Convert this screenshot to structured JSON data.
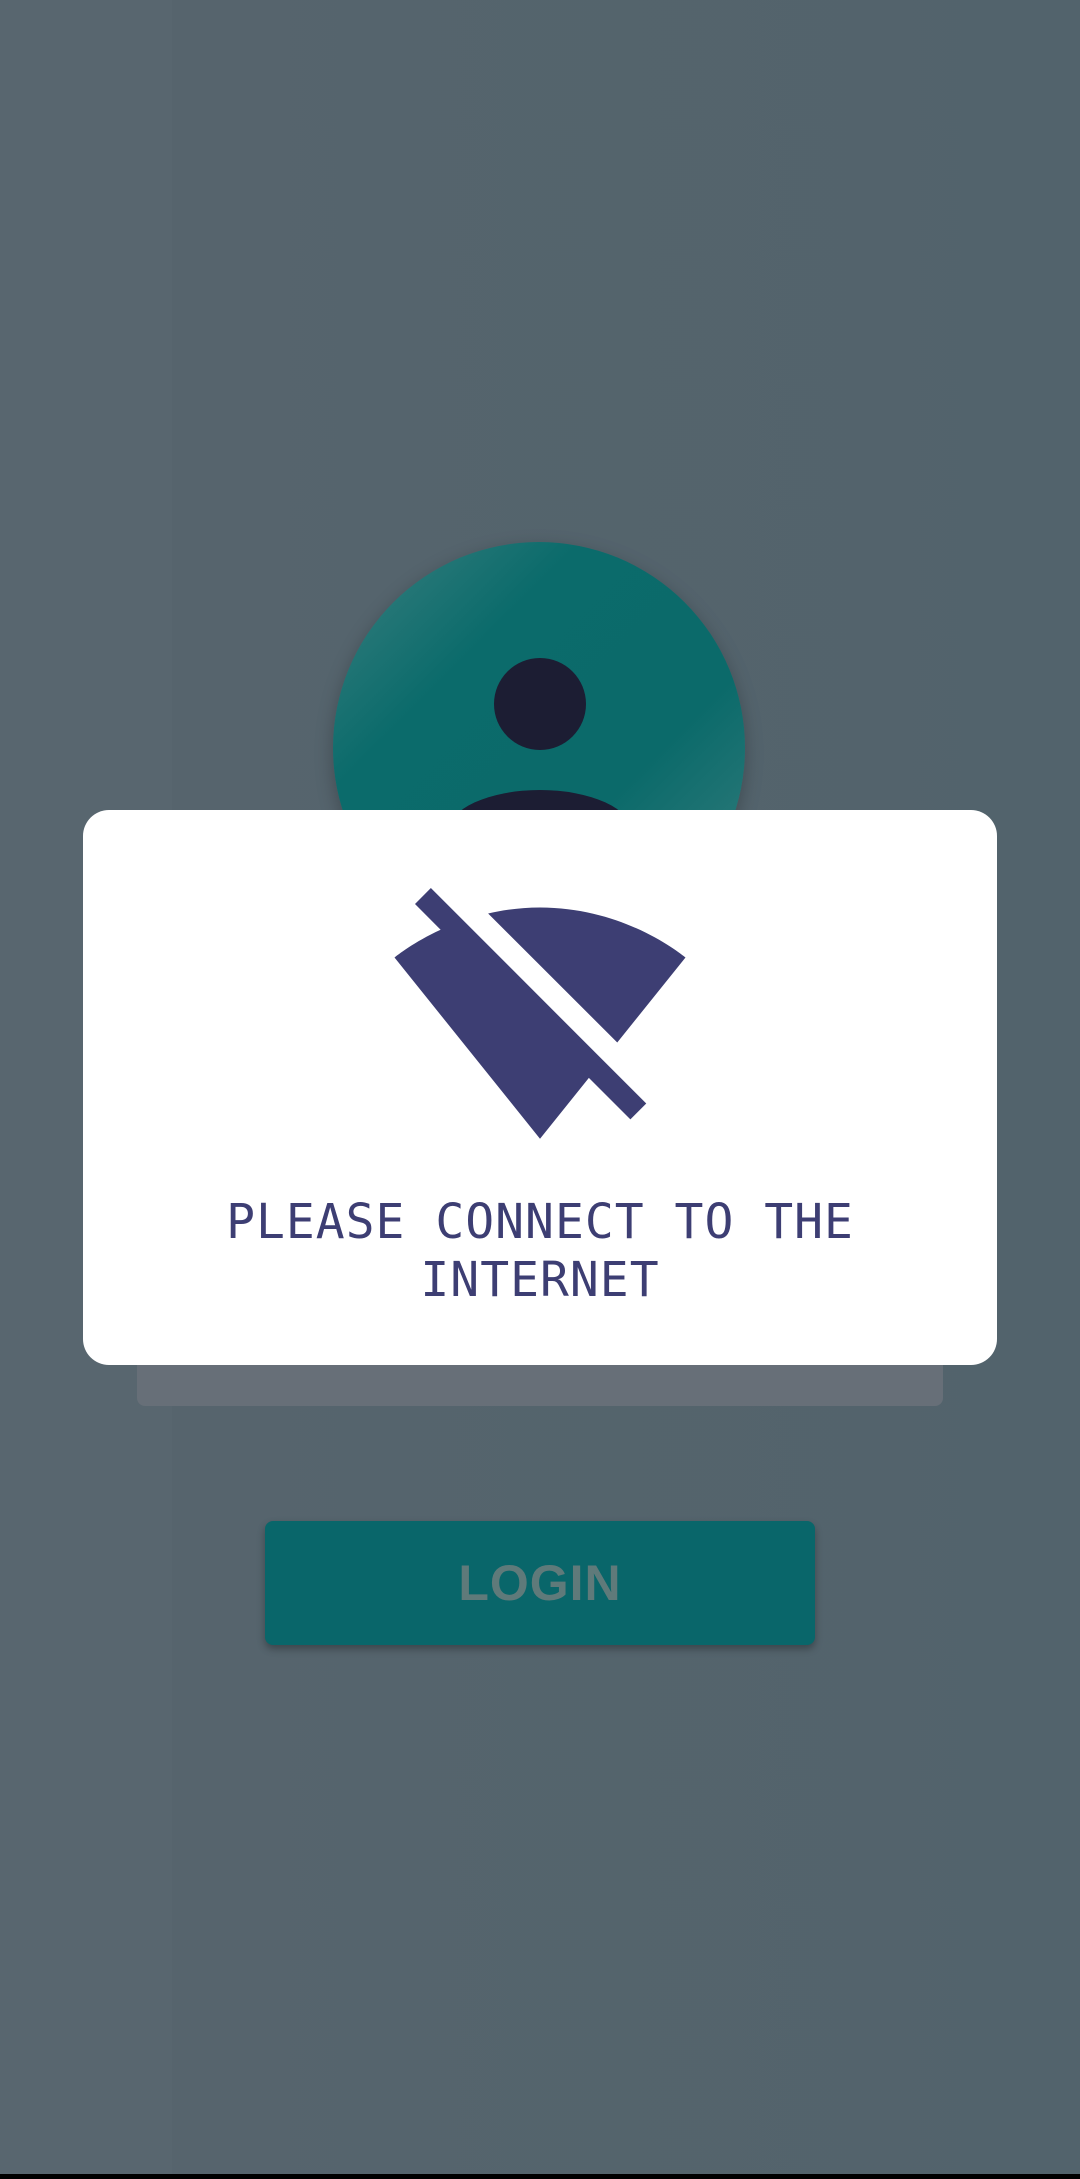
{
  "screen": {
    "background_color": "#55646d"
  },
  "avatar": {
    "icon": "user-avatar-icon",
    "color": "#0b6a6a"
  },
  "login": {
    "label": "LOGIN",
    "color": "#09666a"
  },
  "dialog": {
    "icon": "wifi-off-icon",
    "message": "PLEASE CONNECT TO THE INTERNET",
    "accent_color": "#3d3e73"
  }
}
